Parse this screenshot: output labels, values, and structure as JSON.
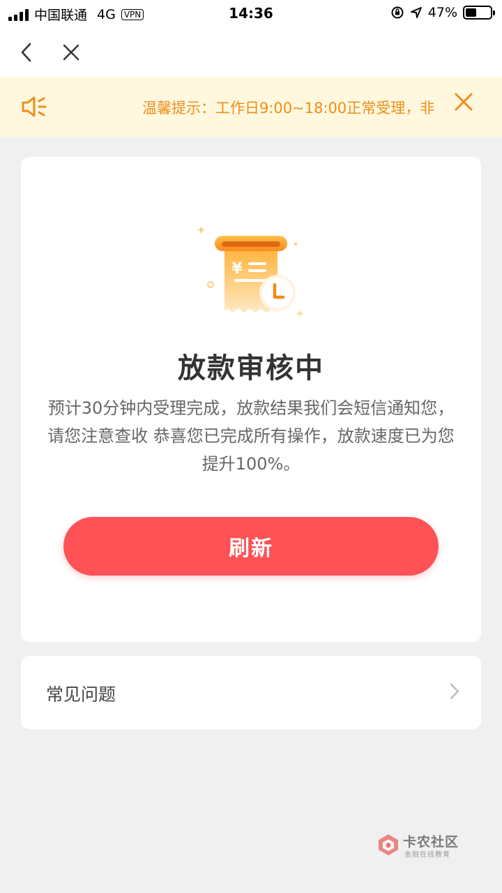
{
  "status_bar": {
    "carrier": "中国联通",
    "network": "4G",
    "vpn": "VPN",
    "time": "14:36",
    "battery": "47%",
    "battery_level": 0.47
  },
  "nav": {
    "back_icon": "chevron-left-icon",
    "close_icon": "close-icon"
  },
  "notice": {
    "icon": "speaker-icon",
    "text": "温馨提示：工作日9:00~18:00正常受理，非",
    "close_icon": "close-icon",
    "accent_color": "#f08c1a",
    "background": "#fff8de"
  },
  "card": {
    "illustration_icon": "receipt-clock-icon",
    "title": "放款审核中",
    "description": "预计30分钟内受理完成，放款结果我们会短信通知您，请您注意查收 恭喜您已完成所有操作，放款速度已为您提升100%。",
    "refresh_label": "刷新",
    "button_color": "#ff5257"
  },
  "faq": {
    "label": "常见问题",
    "chevron_icon": "chevron-right-icon"
  },
  "watermark": {
    "title": "卡农社区",
    "subtitle": "金融在线教育"
  }
}
